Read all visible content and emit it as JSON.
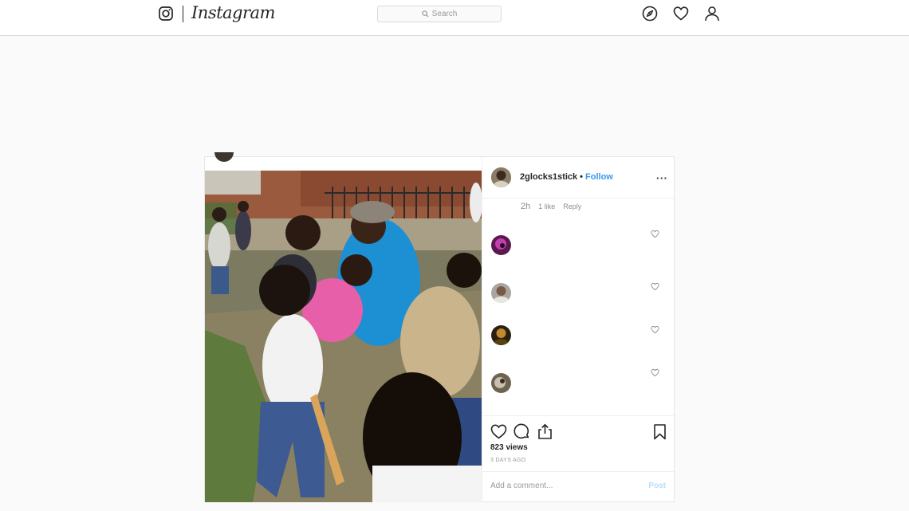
{
  "header": {
    "brand": "Instagram",
    "search_placeholder": "Search"
  },
  "post": {
    "username": "2glocks1stick",
    "separator": "•",
    "follow_label": "Follow",
    "more_label": "···",
    "comment_meta": {
      "time": "2h",
      "likes": "1 like",
      "reply": "Reply"
    },
    "views": "823 views",
    "posted": "3 DAYS AGO",
    "comment_placeholder": "Add a comment...",
    "post_button": "Post"
  },
  "icons": {
    "logo": "instagram-camera-icon",
    "explore": "compass-icon",
    "activity": "heart-icon",
    "profile": "person-icon",
    "like": "heart-icon",
    "comment": "speech-bubble-icon",
    "share": "share-icon",
    "save": "bookmark-icon"
  },
  "colors": {
    "link": "#3897f0",
    "post_disabled": "#b2dffc"
  }
}
